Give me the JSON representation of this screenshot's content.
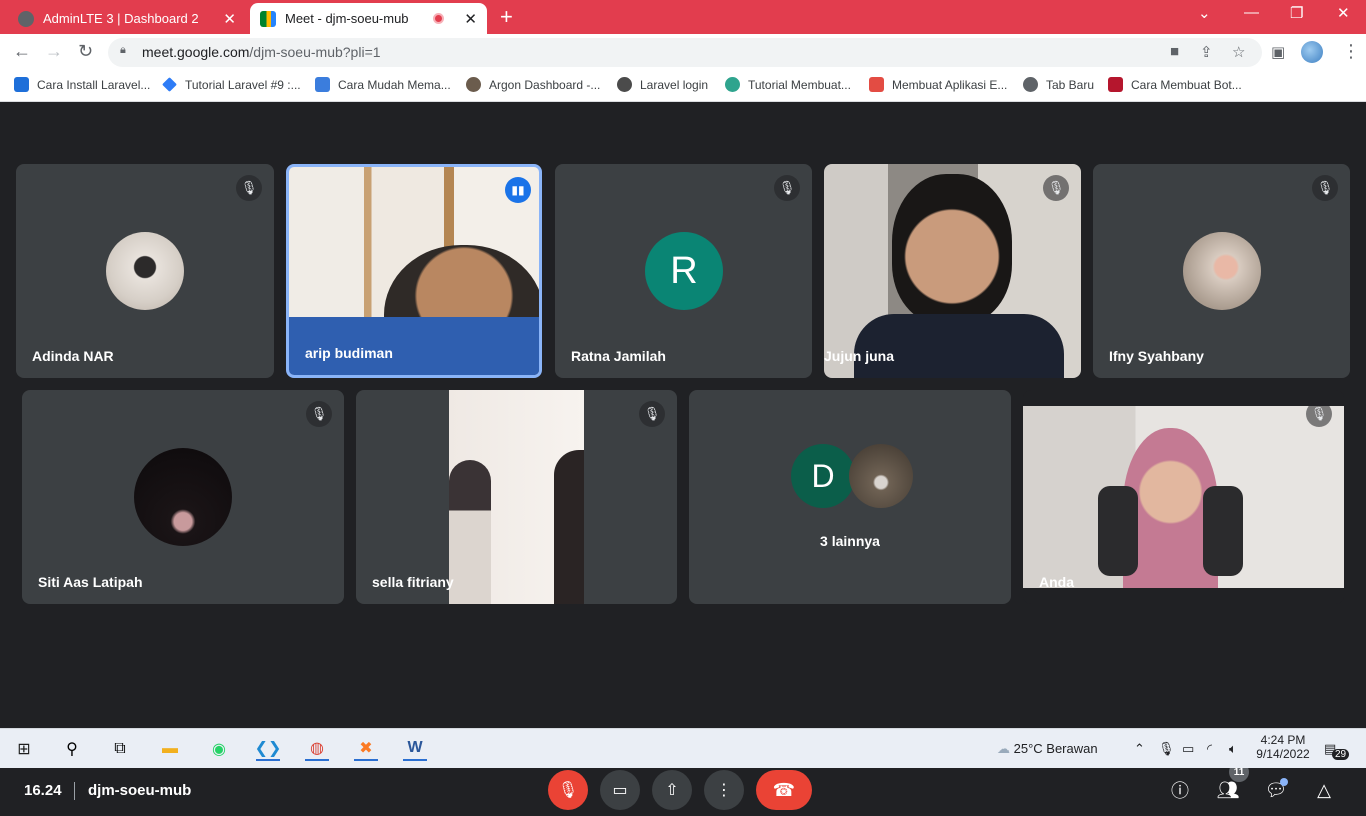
{
  "browser": {
    "tabs": [
      {
        "label": "AdminLTE 3 | Dashboard 2",
        "close": "✕"
      },
      {
        "label": "Meet - djm-soeu-mub",
        "close": "✕"
      }
    ],
    "new_tab": "+",
    "url_host": "meet.google.com",
    "url_path": "/djm-soeu-mub?pli=1",
    "bookmarks": [
      "Cara Install Laravel...",
      "Tutorial Laravel #9 :...",
      "Cara Mudah Mema...",
      "Argon Dashboard -...",
      "Laravel login",
      "Tutorial Membuat...",
      "Membuat Aplikasi E...",
      "Tab Baru",
      "Cara Membuat Bot..."
    ]
  },
  "participants": [
    {
      "name": "Adinda NAR"
    },
    {
      "name": "arip budiman"
    },
    {
      "name": "Ratna Jamilah",
      "initial": "R"
    },
    {
      "name": "Jujun juna"
    },
    {
      "name": "Ifny Syahbany"
    },
    {
      "name": "Siti Aas Latipah"
    },
    {
      "name": "sella fitriany"
    },
    {
      "name": "3 lainnya",
      "initial": "D"
    },
    {
      "name": "Anda"
    }
  ],
  "meeting": {
    "time": "16.24",
    "code": "djm-soeu-mub",
    "people_count": "11"
  },
  "taskbar": {
    "weather": "25°C  Berawan",
    "time": "4:24 PM",
    "date": "9/14/2022",
    "notifications": "29"
  },
  "colors": {
    "title_bar": "#e23d4e",
    "meet_bg": "#202124",
    "tile_bg": "#3c4043",
    "hangup": "#ea4335",
    "speaking": "#1a73e8",
    "avatar_green": "#0b8043"
  }
}
